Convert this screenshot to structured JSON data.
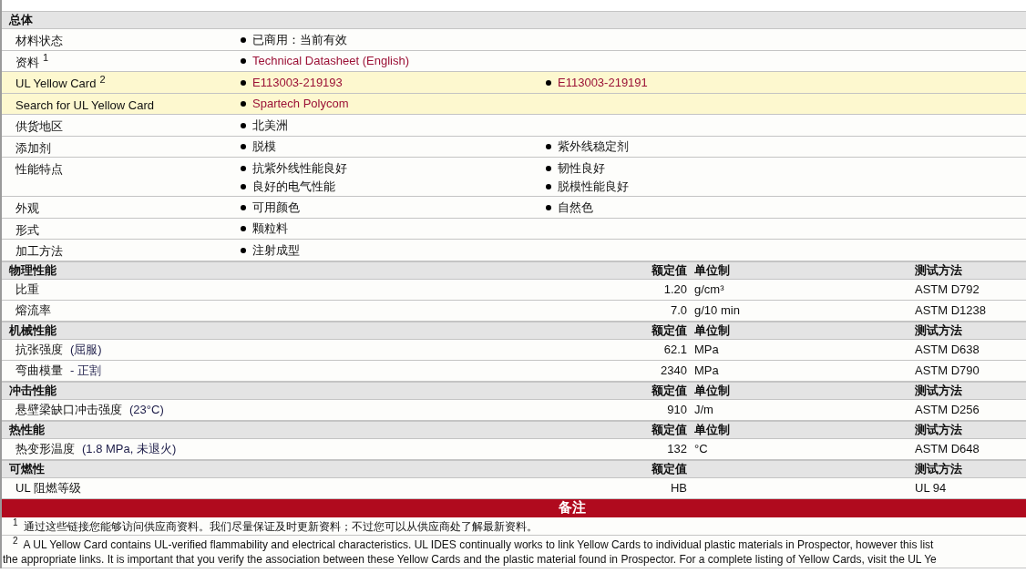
{
  "general": {
    "title": "总体",
    "rows": [
      {
        "label": "材料状态",
        "highlighted": false,
        "columns": [
          [
            {
              "text": "已商用：当前有效",
              "link": false
            }
          ]
        ]
      },
      {
        "label": "资料",
        "note": "1",
        "highlighted": false,
        "columns": [
          [
            {
              "text": "Technical Datasheet (English)",
              "link": true
            }
          ]
        ]
      },
      {
        "label": "UL Yellow Card",
        "note": "2",
        "highlighted": true,
        "columns": [
          [
            {
              "text": "E113003-219193",
              "link": true
            }
          ],
          [
            {
              "text": "E113003-219191",
              "link": true
            }
          ]
        ]
      },
      {
        "label": "Search for UL Yellow Card",
        "highlighted": true,
        "columns": [
          [
            {
              "text": "Spartech Polycom",
              "link": true
            }
          ]
        ]
      },
      {
        "label": "供货地区",
        "highlighted": false,
        "columns": [
          [
            {
              "text": "北美洲",
              "link": false
            }
          ]
        ]
      },
      {
        "label": "添加剂",
        "highlighted": false,
        "columns": [
          [
            {
              "text": "脱模",
              "link": false
            }
          ],
          [
            {
              "text": "紫外线稳定剂",
              "link": false
            }
          ]
        ]
      },
      {
        "label": "性能特点",
        "highlighted": false,
        "columns": [
          [
            {
              "text": "抗紫外线性能良好",
              "link": false
            },
            {
              "text": "良好的电气性能",
              "link": false
            }
          ],
          [
            {
              "text": "韧性良好",
              "link": false
            },
            {
              "text": "脱模性能良好",
              "link": false
            }
          ]
        ]
      },
      {
        "label": "外观",
        "highlighted": false,
        "columns": [
          [
            {
              "text": "可用颜色",
              "link": false
            }
          ],
          [
            {
              "text": "自然色",
              "link": false
            }
          ]
        ]
      },
      {
        "label": "形式",
        "highlighted": false,
        "columns": [
          [
            {
              "text": "颗粒料",
              "link": false
            }
          ]
        ]
      },
      {
        "label": "加工方法",
        "highlighted": false,
        "columns": [
          [
            {
              "text": "注射成型",
              "link": false
            }
          ]
        ]
      }
    ]
  },
  "property_sections": [
    {
      "title": "物理性能",
      "value_header": "额定值",
      "unit_header": "单位制",
      "method_header": "测试方法",
      "rows": [
        {
          "name": "比重",
          "value": "1.20",
          "unit": "g/cm³",
          "method": "ASTM D792"
        },
        {
          "name": "熔流率",
          "value": "7.0",
          "unit": "g/10 min",
          "method": "ASTM D1238"
        }
      ]
    },
    {
      "title": "机械性能",
      "value_header": "额定值",
      "unit_header": "单位制",
      "method_header": "测试方法",
      "rows": [
        {
          "name": "抗张强度",
          "condition": "(屈服)",
          "value": "62.1",
          "unit": "MPa",
          "method": "ASTM D638"
        },
        {
          "name": "弯曲模量",
          "condition": "- 正割",
          "value": "2340",
          "unit": "MPa",
          "method": "ASTM D790"
        }
      ]
    },
    {
      "title": "冲击性能",
      "value_header": "额定值",
      "unit_header": "单位制",
      "method_header": "测试方法",
      "rows": [
        {
          "name": "悬壁梁缺口冲击强度",
          "condition": "(23°C)",
          "value": "910",
          "unit": "J/m",
          "method": "ASTM D256"
        }
      ]
    },
    {
      "title": "热性能",
      "value_header": "额定值",
      "unit_header": "单位制",
      "method_header": "测试方法",
      "rows": [
        {
          "name": "热变形温度",
          "condition": "(1.8 MPa, 未退火)",
          "value": "132",
          "unit": "°C",
          "method": "ASTM D648"
        }
      ]
    },
    {
      "title": "可燃性",
      "value_header": "额定值",
      "method_header": "测试方法",
      "rows": [
        {
          "name": "UL 阻燃等级",
          "value": "HB",
          "method": "UL 94"
        }
      ]
    }
  ],
  "notes": {
    "title": "备注",
    "items": [
      {
        "mark": "1",
        "lines": [
          "通过这些链接您能够访问供应商资料。我们尽量保证及时更新资料；不过您可以从供应商处了解最新资料。"
        ]
      },
      {
        "mark": "2",
        "lines": [
          "A UL Yellow Card contains UL-verified flammability and electrical characteristics. UL IDES continually works to link Yellow Cards to individual plastic materials in Prospector, however this list",
          "the appropriate links. It is important that you verify the association between these Yellow Cards and the plastic material found in Prospector. For a complete listing of Yellow Cards, visit the UL Ye"
        ]
      }
    ]
  }
}
